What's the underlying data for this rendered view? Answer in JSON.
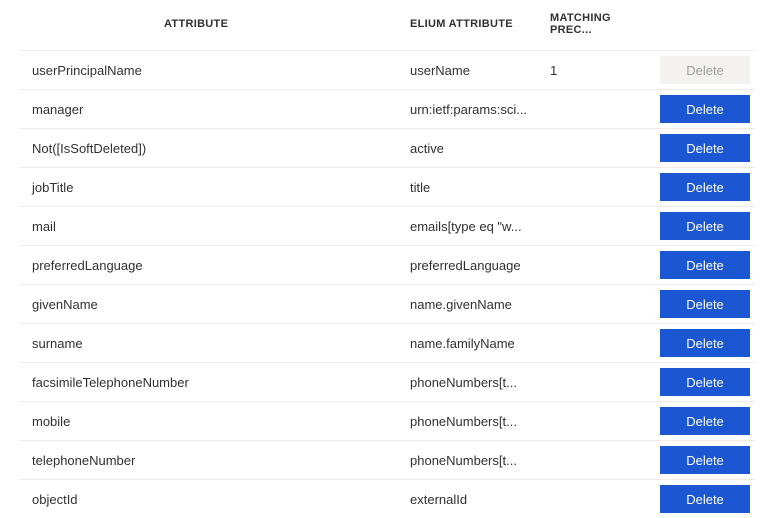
{
  "headers": {
    "attribute": "ATTRIBUTE",
    "elium": "ELIUM ATTRIBUTE",
    "precedence": "MATCHING PREC..."
  },
  "rows": [
    {
      "attribute": "userPrincipalName",
      "elium": "userName",
      "precedence": "1",
      "delete_label": "Delete",
      "delete_disabled": true
    },
    {
      "attribute": "manager",
      "elium": "urn:ietf:params:sci...",
      "precedence": "",
      "delete_label": "Delete",
      "delete_disabled": false
    },
    {
      "attribute": "Not([IsSoftDeleted])",
      "elium": "active",
      "precedence": "",
      "delete_label": "Delete",
      "delete_disabled": false
    },
    {
      "attribute": "jobTitle",
      "elium": "title",
      "precedence": "",
      "delete_label": "Delete",
      "delete_disabled": false
    },
    {
      "attribute": "mail",
      "elium": "emails[type eq \"w...",
      "precedence": "",
      "delete_label": "Delete",
      "delete_disabled": false
    },
    {
      "attribute": "preferredLanguage",
      "elium": "preferredLanguage",
      "precedence": "",
      "delete_label": "Delete",
      "delete_disabled": false
    },
    {
      "attribute": "givenName",
      "elium": "name.givenName",
      "precedence": "",
      "delete_label": "Delete",
      "delete_disabled": false
    },
    {
      "attribute": "surname",
      "elium": "name.familyName",
      "precedence": "",
      "delete_label": "Delete",
      "delete_disabled": false
    },
    {
      "attribute": "facsimileTelephoneNumber",
      "elium": "phoneNumbers[t...",
      "precedence": "",
      "delete_label": "Delete",
      "delete_disabled": false
    },
    {
      "attribute": "mobile",
      "elium": "phoneNumbers[t...",
      "precedence": "",
      "delete_label": "Delete",
      "delete_disabled": false
    },
    {
      "attribute": "telephoneNumber",
      "elium": "phoneNumbers[t...",
      "precedence": "",
      "delete_label": "Delete",
      "delete_disabled": false
    },
    {
      "attribute": "objectId",
      "elium": "externalId",
      "precedence": "",
      "delete_label": "Delete",
      "delete_disabled": false
    }
  ]
}
